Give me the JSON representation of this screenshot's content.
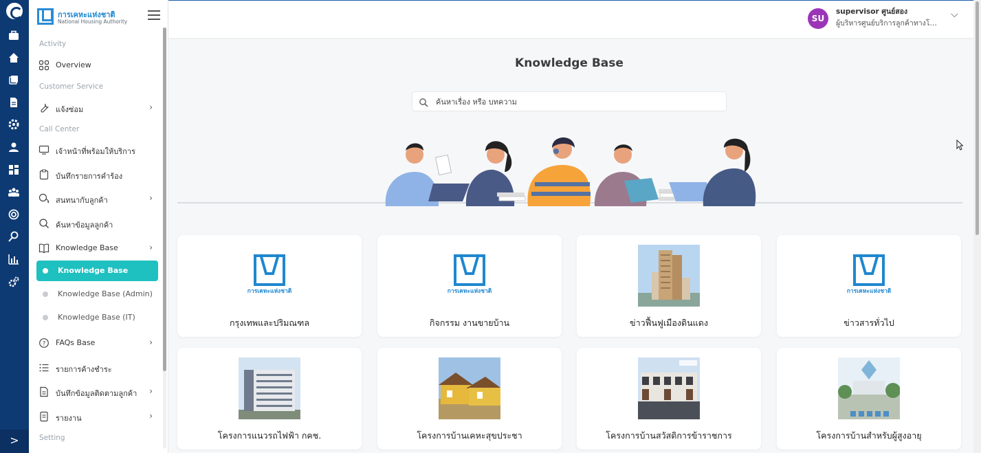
{
  "brand": {
    "name": "การเคหะแห่งชาติ",
    "subtitle": "National Housing Authority"
  },
  "sidebar": {
    "sections": [
      {
        "label": "Activity"
      },
      {
        "label": "Customer Service"
      },
      {
        "label": "Call Center"
      },
      {
        "label": "Setting"
      }
    ],
    "items": [
      {
        "label": "Overview",
        "icon": "grid-icon"
      },
      {
        "label": "แจ้งซ่อม",
        "icon": "wrench-icon"
      },
      {
        "label": "เจ้าหน้าที่พร้อมให้บริการ",
        "icon": "monitor-icon"
      },
      {
        "label": "บันทึกรายการคำร้อง",
        "icon": "clipboard-icon"
      },
      {
        "label": "สนทนากับลูกค้า",
        "icon": "chat-icon"
      },
      {
        "label": "ค้นหาข้อมูลลูกค้า",
        "icon": "search-icon"
      },
      {
        "label": "Knowledge Base",
        "icon": "book-icon"
      },
      {
        "label": "FAQs Base",
        "icon": "question-icon"
      },
      {
        "label": "รายการค้างชำระ",
        "icon": "list-icon"
      },
      {
        "label": "บันทึกข้อมูลติดตามลูกค้า",
        "icon": "document-icon"
      },
      {
        "label": "รายงาน",
        "icon": "report-icon"
      }
    ],
    "kb_subitems": [
      {
        "label": "Knowledge Base",
        "active": true
      },
      {
        "label": "Knowledge Base (Admin)",
        "active": false
      },
      {
        "label": "Knowledge Base (IT)",
        "active": false
      }
    ]
  },
  "rail": {
    "expand_label": ">"
  },
  "user": {
    "initials": "SU",
    "name": "supervisor ศูนย์สอง",
    "role": "ผู้บริหารศูนย์บริการลูกค้าทางโทรศัพท์",
    "avatar_color": "#9b35b8"
  },
  "main": {
    "title": "Knowledge Base",
    "search_placeholder": "ค้นหาเรื่อง หรือ บทความ"
  },
  "cards": [
    {
      "title": "กรุงเทพและปริมณฑล",
      "image": "nha-logo"
    },
    {
      "title": "กิจกรรม งานขายบ้าน",
      "image": "nha-logo"
    },
    {
      "title": "ข่าวฟื้นฟูเมืองดินแดง",
      "image": "tower-photo"
    },
    {
      "title": "ข่าวสารทั่วไป",
      "image": "nha-logo"
    },
    {
      "title": "โครงการแนวรถไฟฟ้า กคช.",
      "image": "apartment-photo"
    },
    {
      "title": "โครงการบ้านเคหะสุขประชา",
      "image": "houses-photo"
    },
    {
      "title": "โครงการบ้านสวัสดิการข้าราชการ",
      "image": "townhouse-photo"
    },
    {
      "title": "โครงการบ้านสำหรับผู้สูงอายุ",
      "image": "elderly-project-photo"
    }
  ],
  "logo_caption": "การเคหะแห่งชาติ",
  "colors": {
    "rail": "#0e3a73",
    "accent": "#1fc0c0",
    "brand_blue": "#2a8bd6"
  }
}
